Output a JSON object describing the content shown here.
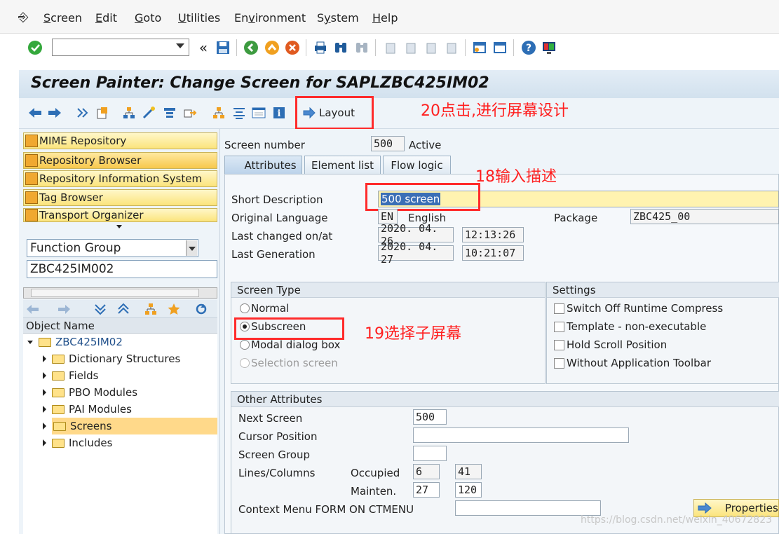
{
  "menu": [
    "Screen",
    "Edit",
    "Goto",
    "Utilities",
    "Environment",
    "System",
    "Help"
  ],
  "menu_underline": [
    "S",
    "E",
    "G",
    "U",
    "v",
    "y",
    "H"
  ],
  "title": "Screen Painter: Change Screen for SAPLZBC425IM02",
  "layout_button": "Layout",
  "annotations": {
    "a20": "20点击,进行屏幕设计",
    "a18": "18输入描述",
    "a19": "19选择子屏幕"
  },
  "nav": {
    "items": [
      "MIME Repository",
      "Repository Browser",
      "Repository Information System",
      "Tag Browser",
      "Transport Organizer"
    ],
    "object_type": "Function Group",
    "object_name": "ZBC425IM002",
    "tree_header": "Object Name",
    "tree_root": "ZBC425IM02",
    "tree_items": [
      "Dictionary Structures",
      "Fields",
      "PBO Modules",
      "PAI Modules",
      "Screens",
      "Includes"
    ]
  },
  "screen": {
    "number_label": "Screen number",
    "number": "500",
    "status": "Active",
    "tabs": [
      "Attributes",
      "Element list",
      "Flow logic"
    ],
    "short_desc_label": "Short Description",
    "short_desc": "500 screen",
    "orig_lang_label": "Original Language",
    "orig_lang_code": "EN",
    "orig_lang": "English",
    "package_label": "Package",
    "package": "ZBC425_00",
    "last_changed_label": "Last changed on/at",
    "last_changed_date": "2020. 04. 26",
    "last_changed_time": "12:13:26",
    "last_gen_label": "Last Generation",
    "last_gen_date": "2020. 04. 27",
    "last_gen_time": "10:21:07"
  },
  "screen_type": {
    "title": "Screen Type",
    "options": [
      "Normal",
      "Subscreen",
      "Modal dialog box",
      "Selection screen"
    ],
    "selected": "Subscreen"
  },
  "settings": {
    "title": "Settings",
    "options": [
      "Switch Off Runtime Compress",
      "Template - non-executable",
      "Hold Scroll Position",
      "Without Application Toolbar"
    ]
  },
  "other": {
    "title": "Other Attributes",
    "next_screen_label": "Next Screen",
    "next_screen": "500",
    "cursor_label": "Cursor Position",
    "screen_group_label": "Screen Group",
    "lines_label": "Lines/Columns",
    "occupied_label": "Occupied",
    "occupied_lines": "6",
    "occupied_cols": "41",
    "mainten_label": "Mainten.",
    "mainten_lines": "27",
    "mainten_cols": "120",
    "context_label": "Context Menu FORM ON CTMENU",
    "properties_button": "Properties"
  },
  "watermark": "https://blog.csdn.net/weixin_40672823",
  "colors": {
    "annotation": "#ff1f1f",
    "nav_button": "#fbe47c",
    "selection": "#ffd98a",
    "selected_text_bg": "#3b6fb6"
  }
}
